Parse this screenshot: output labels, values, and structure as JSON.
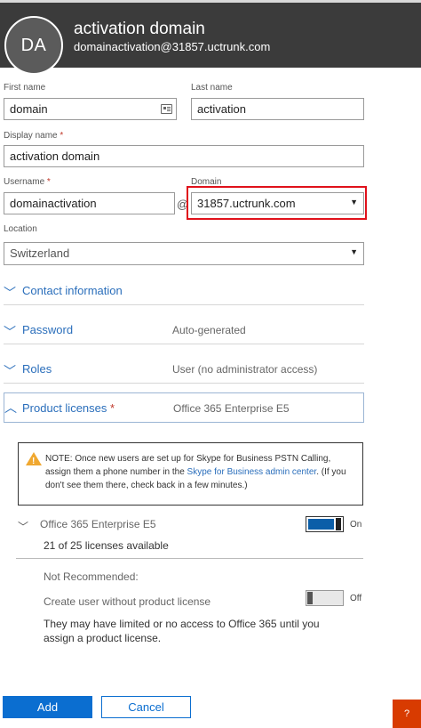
{
  "header": {
    "avatar_initials": "DA",
    "display_name": "activation domain",
    "email": "domainactivation@31857.uctrunk.com"
  },
  "form": {
    "first_name_label": "First name",
    "first_name_value": "domain",
    "last_name_label": "Last name",
    "last_name_value": "activation",
    "display_name_label": "Display name",
    "display_name_value": "activation domain",
    "username_label": "Username",
    "username_value": "domainactivation",
    "at_symbol": "@",
    "domain_label": "Domain",
    "domain_value": "31857.uctrunk.com",
    "location_label": "Location",
    "location_value": "Switzerland",
    "required_marker": "*"
  },
  "sections": {
    "contact": {
      "title": "Contact information",
      "value": ""
    },
    "password": {
      "title": "Password",
      "value": "Auto-generated"
    },
    "roles": {
      "title": "Roles",
      "value": "User (no administrator access)"
    },
    "licenses": {
      "title": "Product licenses",
      "value": "Office 365 Enterprise E5"
    }
  },
  "note": {
    "text_before_link": "NOTE: Once new users are set up for Skype for Business PSTN Calling, assign them a phone number in the ",
    "link_text": "Skype for Business admin center",
    "text_after_link": ". (If you don't see them there, check back in a few minutes.)"
  },
  "license": {
    "product_name": "Office 365 Enterprise E5",
    "availability": "21 of 25 licenses available",
    "toggle_label": "On",
    "enabled": true
  },
  "not_recommended": {
    "heading": "Not Recommended:",
    "option_label": "Create user without product license",
    "toggle_label": "Off",
    "enabled": false,
    "description": "They may have limited or no access to Office 365 until you assign a product license."
  },
  "buttons": {
    "add": "Add",
    "cancel": "Cancel",
    "help": "?"
  },
  "icons": {
    "expand": "chevron-down-icon",
    "collapse": "chevron-up-icon",
    "warning": "warning-icon",
    "contact_card": "contact-card-icon",
    "dropdown": "caret-down-icon"
  },
  "colors": {
    "accent": "#0b6ed0",
    "header_bg": "#3b3b3b",
    "highlight": "#e0111b",
    "help": "#d83b01"
  }
}
